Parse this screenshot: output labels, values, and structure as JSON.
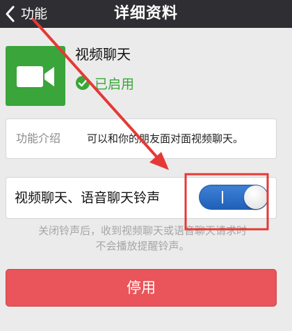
{
  "navbar": {
    "back_label": "功能",
    "title": "详细资料"
  },
  "plugin": {
    "name": "视频聊天",
    "status": "已启用",
    "icon": "video-camera-icon",
    "icon_color": "#39a53b"
  },
  "intro": {
    "label": "功能介绍",
    "description": "可以和你的朋友面对面视频聊天。"
  },
  "ringtone": {
    "label": "视频聊天、语音聊天铃声",
    "enabled": true,
    "toggle_on_mark": "I",
    "tip_line1": "关闭铃声后，收到视频聊天或语音聊天请求时",
    "tip_line2": "不会播放提醒铃声。"
  },
  "disable_button": {
    "label": "停用",
    "color": "#e9555a"
  },
  "colors": {
    "navbar": "#2f2f33",
    "background": "#ebebeb",
    "status_green": "#3aa638",
    "toggle_blue": "#2a6fc9",
    "annotation_red": "#e53935"
  }
}
